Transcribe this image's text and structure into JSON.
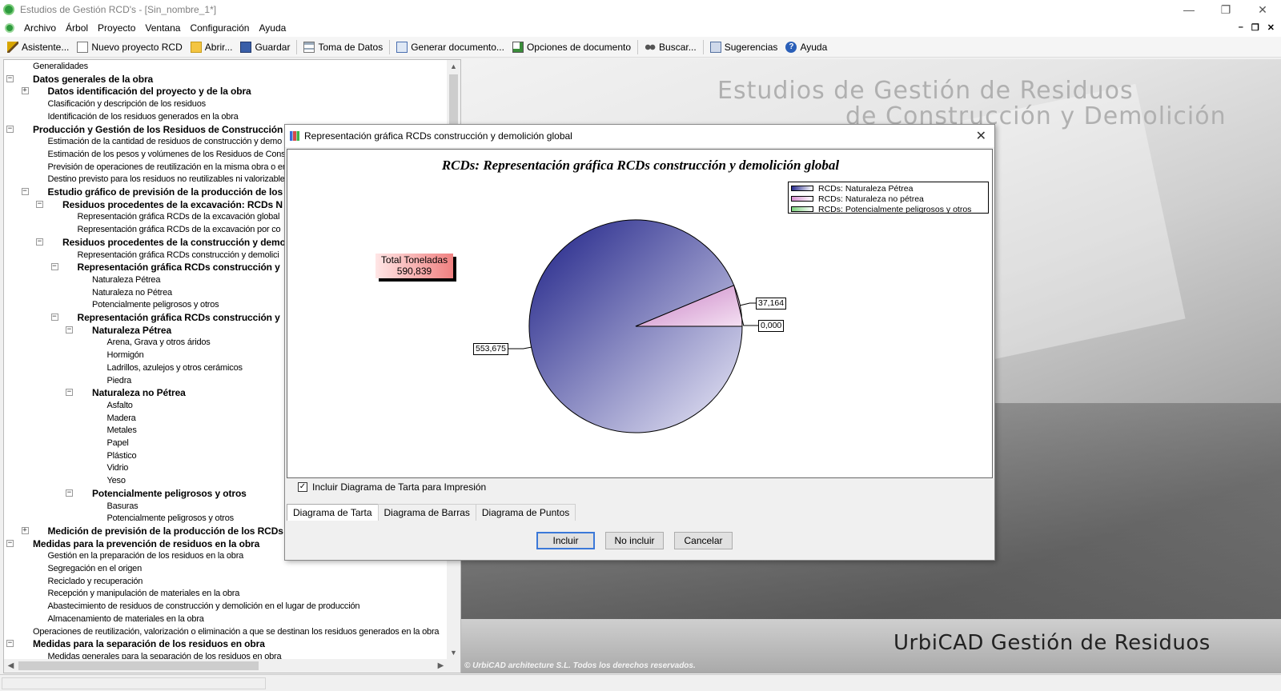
{
  "window": {
    "title": "Estudios de Gestión RCD's - [Sin_nombre_1*]",
    "controls": [
      "—",
      "❐",
      "✕"
    ]
  },
  "menu": {
    "items": [
      "Archivo",
      "Árbol",
      "Proyecto",
      "Ventana",
      "Configuración",
      "Ayuda"
    ],
    "mdi_controls": [
      "–",
      "❐",
      "✕"
    ]
  },
  "toolbar": {
    "buttons": [
      {
        "label": "Asistente...",
        "icon": "wand-icon"
      },
      {
        "label": "Nuevo proyecto RCD",
        "icon": "new-document-icon"
      },
      {
        "label": "Abrir...",
        "icon": "open-folder-icon"
      },
      {
        "label": "Guardar",
        "icon": "save-icon"
      },
      {
        "label": "Toma de Datos",
        "icon": "data-list-icon"
      },
      {
        "label": "Generar documento...",
        "icon": "generate-document-icon"
      },
      {
        "label": "Opciones de documento",
        "icon": "document-options-icon"
      },
      {
        "label": "Buscar...",
        "icon": "binoculars-icon"
      },
      {
        "label": "Sugerencias",
        "icon": "suggestions-icon"
      },
      {
        "label": "Ayuda",
        "icon": "help-icon"
      }
    ]
  },
  "tree": {
    "items": [
      {
        "label": "Generalidades",
        "bold": false,
        "level": 1,
        "expander": ""
      },
      {
        "label": "Datos generales de la obra",
        "bold": true,
        "level": 1,
        "expander": "-"
      },
      {
        "label": "Datos identificación del proyecto y de la obra",
        "bold": true,
        "level": 2,
        "expander": "+"
      },
      {
        "label": "Clasificación y descripción de los residuos",
        "bold": false,
        "level": 2,
        "expander": ""
      },
      {
        "label": "Identificación de los residuos generados en la obra",
        "bold": false,
        "level": 2,
        "expander": ""
      },
      {
        "label": "Producción y Gestión de los Residuos de Construcción",
        "bold": true,
        "level": 1,
        "expander": "-"
      },
      {
        "label": "Estimación de la cantidad de residuos de construcción y demo",
        "bold": false,
        "level": 2,
        "expander": ""
      },
      {
        "label": "Estimación de los pesos y volúmenes de los Residuos de Cons",
        "bold": false,
        "level": 2,
        "expander": ""
      },
      {
        "label": "Previsión de operaciones de reutilización en la misma obra o en",
        "bold": false,
        "level": 2,
        "expander": ""
      },
      {
        "label": "Destino previsto para los residuos no reutilizables ni valorizable",
        "bold": false,
        "level": 2,
        "expander": ""
      },
      {
        "label": "Estudio gráfico de previsión de la producción de los",
        "bold": true,
        "level": 2,
        "expander": "-"
      },
      {
        "label": "Residuos procedentes de la excavación: RCDs N",
        "bold": true,
        "level": 3,
        "expander": "-"
      },
      {
        "label": "Representación gráfica RCDs de la excavación global",
        "bold": false,
        "level": 4,
        "expander": ""
      },
      {
        "label": "Representación gráfica RCDs de la excavación por co",
        "bold": false,
        "level": 4,
        "expander": ""
      },
      {
        "label": "Residuos procedentes de la construcción y demo",
        "bold": true,
        "level": 3,
        "expander": "-"
      },
      {
        "label": "Representación gráfica RCDs construcción y demolici",
        "bold": false,
        "level": 4,
        "expander": ""
      },
      {
        "label": "Representación gráfica RCDs construcción y",
        "bold": true,
        "level": 4,
        "expander": "-"
      },
      {
        "label": "Naturaleza Pétrea",
        "bold": false,
        "level": 5,
        "expander": ""
      },
      {
        "label": "Naturaleza no Pétrea",
        "bold": false,
        "level": 5,
        "expander": ""
      },
      {
        "label": "Potencialmente peligrosos y otros",
        "bold": false,
        "level": 5,
        "expander": ""
      },
      {
        "label": "Representación gráfica RCDs construcción y",
        "bold": true,
        "level": 4,
        "expander": "-"
      },
      {
        "label": "Naturaleza Pétrea",
        "bold": true,
        "level": 5,
        "expander": "-"
      },
      {
        "label": "Arena, Grava y otros áridos",
        "bold": false,
        "level": 6,
        "expander": ""
      },
      {
        "label": "Hormigón",
        "bold": false,
        "level": 6,
        "expander": ""
      },
      {
        "label": "Ladrillos, azulejos y otros cerámicos",
        "bold": false,
        "level": 6,
        "expander": ""
      },
      {
        "label": "Piedra",
        "bold": false,
        "level": 6,
        "expander": ""
      },
      {
        "label": "Naturaleza no Pétrea",
        "bold": true,
        "level": 5,
        "expander": "-"
      },
      {
        "label": "Asfalto",
        "bold": false,
        "level": 6,
        "expander": ""
      },
      {
        "label": "Madera",
        "bold": false,
        "level": 6,
        "expander": ""
      },
      {
        "label": "Metales",
        "bold": false,
        "level": 6,
        "expander": ""
      },
      {
        "label": "Papel",
        "bold": false,
        "level": 6,
        "expander": ""
      },
      {
        "label": "Plástico",
        "bold": false,
        "level": 6,
        "expander": ""
      },
      {
        "label": "Vidrio",
        "bold": false,
        "level": 6,
        "expander": ""
      },
      {
        "label": "Yeso",
        "bold": false,
        "level": 6,
        "expander": ""
      },
      {
        "label": "Potencialmente peligrosos y otros",
        "bold": true,
        "level": 5,
        "expander": "-"
      },
      {
        "label": "Basuras",
        "bold": false,
        "level": 6,
        "expander": ""
      },
      {
        "label": "Potencialmente peligrosos y otros",
        "bold": false,
        "level": 6,
        "expander": ""
      },
      {
        "label": "Medición de previsión de la producción de los RCDs",
        "bold": true,
        "level": 2,
        "expander": "+"
      },
      {
        "label": "Medidas para la prevención de residuos en la obra",
        "bold": true,
        "level": 1,
        "expander": "-"
      },
      {
        "label": "Gestión en la preparación de los residuos en la obra",
        "bold": false,
        "level": 2,
        "expander": ""
      },
      {
        "label": "Segregación en el origen",
        "bold": false,
        "level": 2,
        "expander": ""
      },
      {
        "label": "Reciclado y recuperación",
        "bold": false,
        "level": 2,
        "expander": ""
      },
      {
        "label": "Recepción y manipulación de materiales en la obra",
        "bold": false,
        "level": 2,
        "expander": ""
      },
      {
        "label": "Abastecimiento de residuos de construcción y demolición en el lugar de producción",
        "bold": false,
        "level": 2,
        "expander": ""
      },
      {
        "label": "Almacenamiento de materiales en la obra",
        "bold": false,
        "level": 2,
        "expander": ""
      },
      {
        "label": "Operaciones de reutilización, valorización o eliminación a que se destinan los residuos generados en la obra",
        "bold": false,
        "level": 1,
        "expander": ""
      },
      {
        "label": "Medidas para la separación de los residuos en obra",
        "bold": true,
        "level": 1,
        "expander": "-"
      },
      {
        "label": "Medidas generales para la separación de los residuos en obra",
        "bold": false,
        "level": 2,
        "expander": ""
      }
    ]
  },
  "background": {
    "title_line1": "Estudios de Gestión de Residuos",
    "title_line2": "de Construcción y Demolición",
    "brand": "UrbiCAD Gestión de Residuos",
    "copyright": "© UrbiCAD architecture S.L. Todos los derechos reservados."
  },
  "dialog": {
    "title": "Representación gráfica RCDs construcción y demolición global",
    "close": "✕",
    "checkbox_label": "Incluir Diagrama de Tarta para Impresión",
    "checkbox_checked": true,
    "checkbox_mark": "✓",
    "tabs": [
      "Diagrama de Tarta",
      "Diagrama de Barras",
      "Diagrama de Puntos"
    ],
    "active_tab": "Diagrama de Tarta",
    "buttons": {
      "include": "Incluir",
      "exclude": "No incluir",
      "cancel": "Cancelar"
    },
    "total_label": "Total Toneladas",
    "total_value": "590,839"
  },
  "chart_data": {
    "type": "pie",
    "title": "RCDs: Representación gráfica RCDs construcción y demolición global",
    "legend_position": "top-right",
    "categories": [
      "RCDs: Naturaleza Pétrea",
      "RCDs: Naturaleza no pétrea",
      "RCDs: Potencialmente peligrosos y otros"
    ],
    "values": [
      553.675,
      37.164,
      0.0
    ],
    "data_labels": [
      "553,675",
      "37,164",
      "0,000"
    ],
    "colors": [
      "#2a2d8f",
      "#d68fd0",
      "#7ed37e"
    ]
  }
}
